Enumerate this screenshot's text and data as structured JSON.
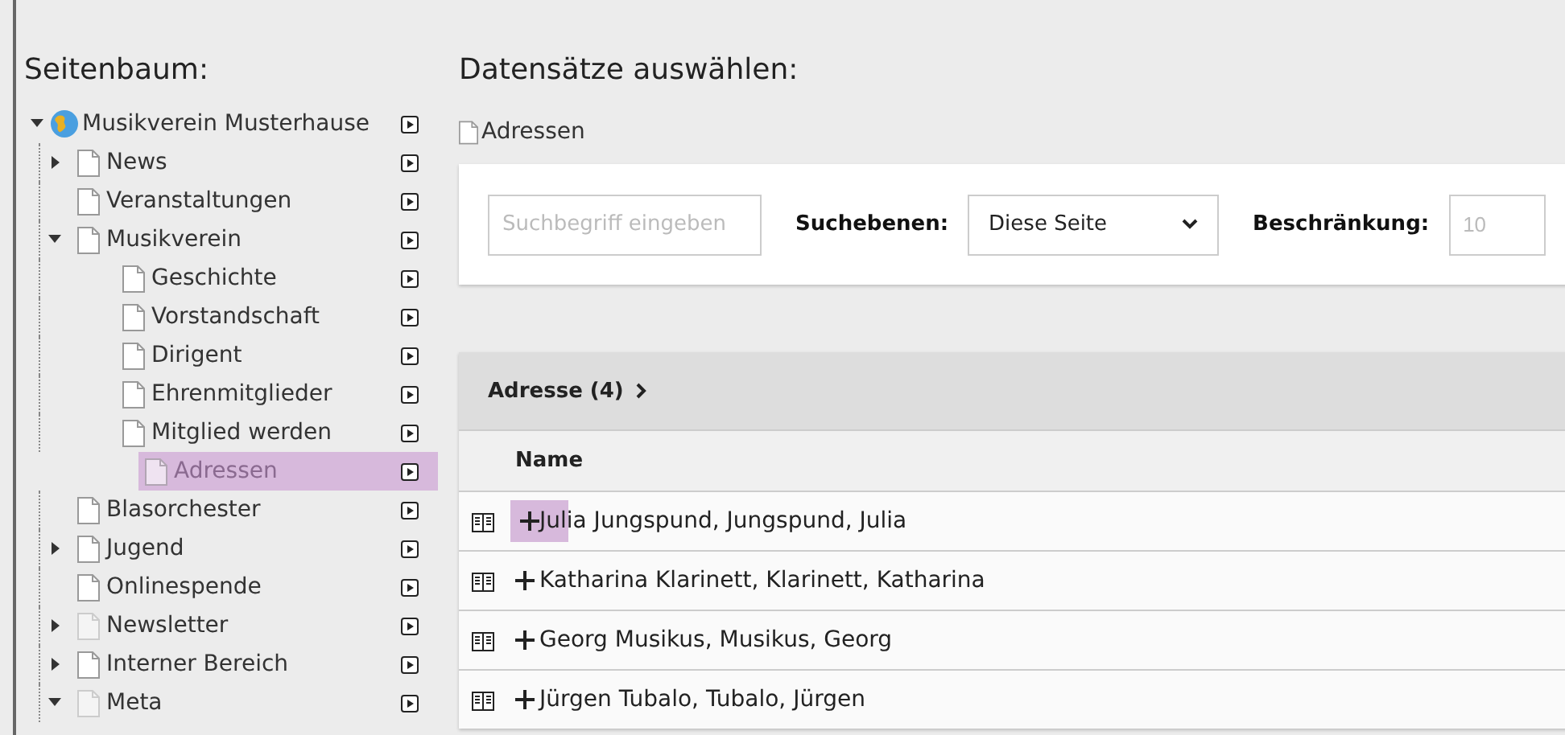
{
  "sidebar": {
    "title": "Seitenbaum:",
    "root": {
      "label": "Musikverein Musterhause",
      "expandable": true,
      "expanded": true,
      "children": [
        {
          "label": "News",
          "expandable": true,
          "expanded": false,
          "selected": false,
          "hidden": false
        },
        {
          "label": "Veranstaltungen",
          "expandable": false,
          "selected": false,
          "hidden": false
        },
        {
          "label": "Musikverein",
          "expandable": true,
          "expanded": true,
          "selected": false,
          "hidden": false,
          "children": [
            {
              "label": "Geschichte",
              "expandable": false,
              "selected": false,
              "hidden": false
            },
            {
              "label": "Vorstandschaft",
              "expandable": false,
              "selected": false,
              "hidden": false
            },
            {
              "label": "Dirigent",
              "expandable": false,
              "selected": false,
              "hidden": false
            },
            {
              "label": "Ehrenmitglieder",
              "expandable": false,
              "selected": false,
              "hidden": false
            },
            {
              "label": "Mitglied werden",
              "expandable": false,
              "selected": false,
              "hidden": false
            },
            {
              "label": "Adressen",
              "expandable": false,
              "selected": true,
              "hidden": false
            }
          ]
        },
        {
          "label": "Blasorchester",
          "expandable": false,
          "selected": false,
          "hidden": false
        },
        {
          "label": "Jugend",
          "expandable": true,
          "expanded": false,
          "selected": false,
          "hidden": false
        },
        {
          "label": "Onlinespende",
          "expandable": false,
          "selected": false,
          "hidden": false
        },
        {
          "label": "Newsletter",
          "expandable": true,
          "expanded": false,
          "selected": false,
          "hidden": true
        },
        {
          "label": "Interner Bereich",
          "expandable": true,
          "expanded": false,
          "selected": false,
          "hidden": false
        },
        {
          "label": "Meta",
          "expandable": true,
          "expanded": true,
          "selected": false,
          "hidden": true
        }
      ]
    }
  },
  "main": {
    "title": "Datensätze auswählen:",
    "breadcrumb": "Adressen",
    "filter": {
      "search_placeholder": "Suchbegriff eingeben",
      "levels_label": "Suchebenen:",
      "levels_value": "Diese Seite",
      "limit_label": "Beschränkung:",
      "limit_placeholder": "10"
    },
    "table": {
      "title": "Adresse (4)",
      "columns": [
        "Name"
      ],
      "rows": [
        {
          "name": "Julia Jungspund, Jungspund, Julia",
          "highlighted": true
        },
        {
          "name": "Katharina Klarinett, Klarinett, Katharina",
          "highlighted": false
        },
        {
          "name": "Georg Musikus, Musikus, Georg",
          "highlighted": false
        },
        {
          "name": "Jürgen Tubalo, Tubalo, Jürgen",
          "highlighted": false
        }
      ]
    }
  }
}
